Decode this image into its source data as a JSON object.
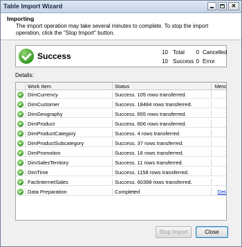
{
  "window": {
    "title": "Table Import Wizard"
  },
  "header": {
    "title": "Importing",
    "description": "The import operation may take several minutes to complete. To stop the import operation, click the \"Stop Import\" button."
  },
  "status": {
    "label": "Success",
    "total_value": "10",
    "total_label": "Total",
    "cancelled_value": "0",
    "cancelled_label": "Cancelled",
    "success_value": "10",
    "success_label": "Success",
    "error_value": "0",
    "error_label": "Error"
  },
  "details": {
    "label": "Details:",
    "columns": [
      "Work Item",
      "Status",
      "Message"
    ],
    "rows": [
      {
        "work_item": "DimCurrency",
        "status": "Success. 105 rows transferred.",
        "message": ""
      },
      {
        "work_item": "DimCustomer",
        "status": "Success. 18484 rows transferred.",
        "message": ""
      },
      {
        "work_item": "DimGeography",
        "status": "Success. 655 rows transferred.",
        "message": ""
      },
      {
        "work_item": "DimProduct",
        "status": "Success. 606 rows transferred.",
        "message": ""
      },
      {
        "work_item": "DimProductCategory",
        "status": "Success. 4 rows transferred.",
        "message": ""
      },
      {
        "work_item": "DimProductSubcategory",
        "status": "Success. 37 rows transferred.",
        "message": ""
      },
      {
        "work_item": "DimPromotion",
        "status": "Success. 16 rows transferred.",
        "message": ""
      },
      {
        "work_item": "DimSalesTerritory",
        "status": "Success. 11 rows transferred.",
        "message": ""
      },
      {
        "work_item": "DimTime",
        "status": "Success. 1158 rows transferred.",
        "message": ""
      },
      {
        "work_item": "FactInternetSales",
        "status": "Success. 60398 rows transferred.",
        "message": ""
      },
      {
        "work_item": "Data Preparation",
        "status": "Completed",
        "message": "Details"
      }
    ]
  },
  "buttons": {
    "stop_import": "Stop Import",
    "close": "Close"
  }
}
